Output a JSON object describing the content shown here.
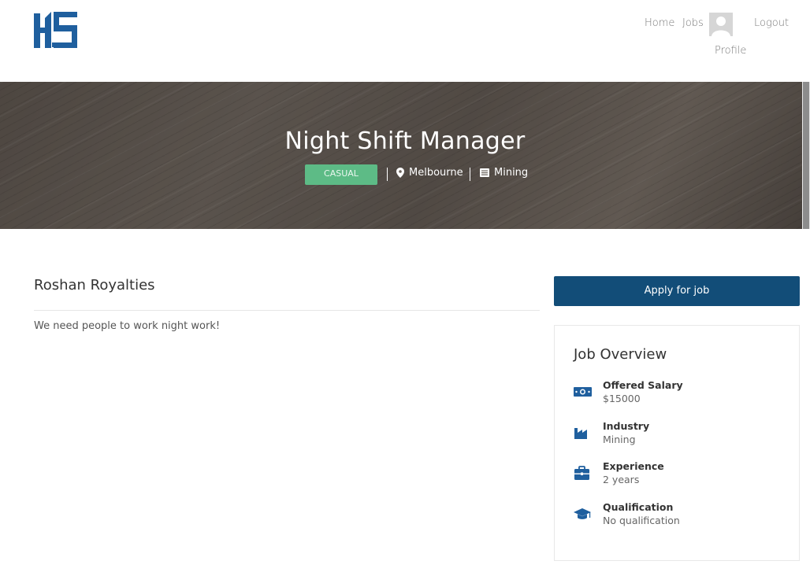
{
  "nav": {
    "home": "Home",
    "jobs": "Jobs",
    "logout": "Logout",
    "profile": "Profile"
  },
  "job": {
    "title": "Night Shift Manager",
    "type_badge": "CASUAL",
    "location": "Melbourne",
    "industry": "Mining",
    "company": "Roshan Royalties",
    "description": "We need people to work night work!"
  },
  "sidebar": {
    "apply_label": "Apply for job",
    "overview_title": "Job Overview",
    "items": [
      {
        "label": "Offered Salary",
        "value": "$15000",
        "icon": "money-icon"
      },
      {
        "label": "Industry",
        "value": "Mining",
        "icon": "factory-icon"
      },
      {
        "label": "Experience",
        "value": "2 years",
        "icon": "briefcase-icon"
      },
      {
        "label": "Qualification",
        "value": "No qualification",
        "icon": "graduation-cap-icon"
      }
    ]
  },
  "colors": {
    "brand_blue": "#124d78",
    "badge_green": "#5dbb86",
    "icon_blue": "#1f5f9e"
  }
}
